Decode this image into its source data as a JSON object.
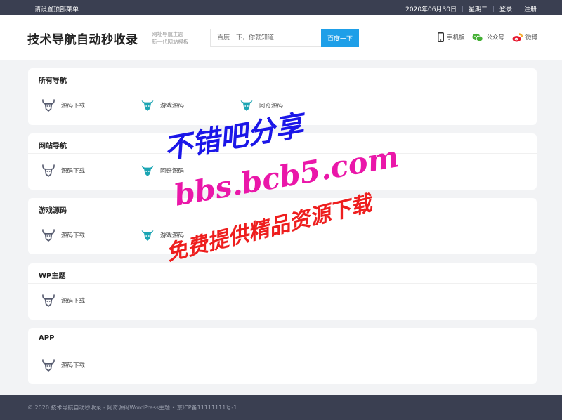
{
  "topbar": {
    "menu_hint": "请设置顶部菜单",
    "date": "2020年06月30日",
    "weekday": "星期二",
    "login": "登录",
    "register": "注册"
  },
  "header": {
    "logo": "技术导航自动秒收录",
    "slogan_line1": "网址导航主题",
    "slogan_line2": "新一代网站模板",
    "search_placeholder": "百度一下，你就知道",
    "search_button": "百度一下",
    "socials": [
      {
        "label": "手机板",
        "icon": "phone-icon"
      },
      {
        "label": "公众号",
        "icon": "wechat-icon"
      },
      {
        "label": "微博",
        "icon": "weibo-icon"
      }
    ]
  },
  "sections": [
    {
      "title": "所有导航",
      "items": [
        {
          "label": "源码下载",
          "icon": "bull-outline-icon",
          "color": "#555a6e"
        },
        {
          "label": "游戏源码",
          "icon": "bull-teal-icon",
          "color": "#1ba5b3"
        },
        {
          "label": "阿奇源码",
          "icon": "bull-teal-icon",
          "color": "#1ba5b3"
        }
      ]
    },
    {
      "title": "网站导航",
      "items": [
        {
          "label": "源码下载",
          "icon": "bull-outline-icon",
          "color": "#555a6e"
        },
        {
          "label": "阿奇源码",
          "icon": "bull-teal-icon",
          "color": "#1ba5b3"
        }
      ]
    },
    {
      "title": "游戏源码",
      "items": [
        {
          "label": "源码下载",
          "icon": "bull-outline-icon",
          "color": "#555a6e"
        },
        {
          "label": "游戏源码",
          "icon": "bull-teal-icon",
          "color": "#1ba5b3"
        }
      ]
    },
    {
      "title": "WP主题",
      "items": [
        {
          "label": "源码下载",
          "icon": "bull-outline-icon",
          "color": "#555a6e"
        }
      ]
    },
    {
      "title": "APP",
      "items": [
        {
          "label": "源码下载",
          "icon": "bull-outline-icon",
          "color": "#555a6e"
        }
      ]
    }
  ],
  "footer": {
    "text": "© 2020 技术导航自动秒收录 - 阿奇源码WordPress主题 • 京ICP备11111111号-1"
  },
  "watermark": {
    "line1": "不错吧分享",
    "line2": "bbs.bcb5.com",
    "line3": "免费提供精品资源下载"
  },
  "colors": {
    "topbar_bg": "#3a3f51",
    "accent": "#1e9fe8",
    "page_bg": "#f2f3f5"
  }
}
